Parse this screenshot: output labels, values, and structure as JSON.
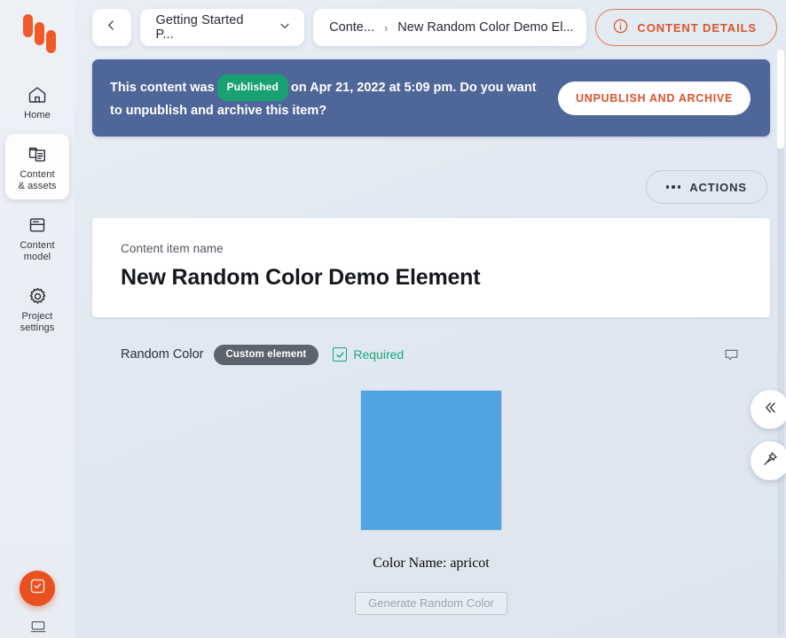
{
  "app": {
    "logo_name": "kontent-logo"
  },
  "sidebar": {
    "items": [
      {
        "label": "Home",
        "icon": "home-icon",
        "active": false
      },
      {
        "label": "Content\n& assets",
        "line1": "Content",
        "line2": "& assets",
        "icon": "content-assets-icon",
        "active": true
      },
      {
        "label": "Content model",
        "line1": "Content",
        "line2": "model",
        "icon": "content-model-icon",
        "active": false
      },
      {
        "label": "Project settings",
        "line1": "Project",
        "line2": "settings",
        "icon": "gear-icon",
        "active": false
      }
    ],
    "chat_fab": "chat-bubble-check-icon"
  },
  "topbar": {
    "back_icon": "chevron-left-icon",
    "project_name": "Getting Started P...",
    "project_dropdown_icon": "chevron-down-icon",
    "breadcrumb": {
      "items": [
        "Conte...",
        "New Random Color Demo El..."
      ],
      "separator": "›"
    },
    "content_details": {
      "label": "CONTENT DETAILS",
      "icon": "info-circle-icon"
    }
  },
  "banner": {
    "text_before": "This content was",
    "status_badge": "Published",
    "text_after": "on Apr 21, 2022 at 5:09 pm. Do you want to unpublish and archive this item?",
    "button_label": "UNPUBLISH AND ARCHIVE",
    "background_color": "#4F6699",
    "badge_color": "#19A172"
  },
  "actions": {
    "label": "ACTIONS",
    "icon": "ellipsis-icon"
  },
  "name_card": {
    "label": "Content item name",
    "value": "New Random Color Demo Element"
  },
  "field": {
    "label": "Random Color",
    "chip": "Custom element",
    "required_label": "Required",
    "required_checked": true,
    "required_color": "#1AA67F",
    "comment_icon": "comment-bubble-icon"
  },
  "custom_element": {
    "swatch_color": "#52A3E2",
    "color_name_text": "Color Name: apricot",
    "generate_button_label": "Generate Random Color",
    "generate_button_disabled": true
  },
  "rail": {
    "collapse_icon": "double-chevron-left-icon",
    "pin_icon": "pin-icon"
  }
}
